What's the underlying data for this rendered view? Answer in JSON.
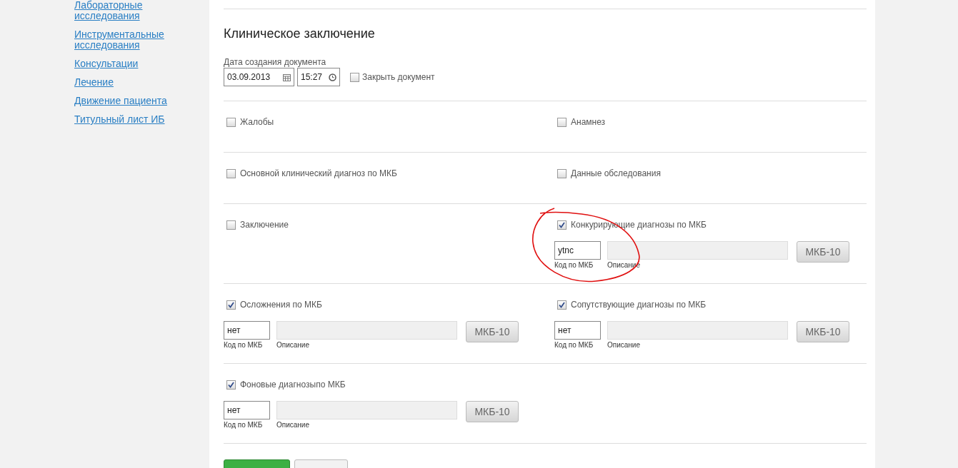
{
  "sidebar": {
    "links": [
      "Лабораторные исследования",
      "Инструментальные исследования",
      "Консультации",
      "Лечение",
      "Движение пациента",
      "Титульный лист ИБ"
    ]
  },
  "form": {
    "title": "Клиническое заключение",
    "date_label": "Дата создания документа",
    "date": "03.09.2013",
    "time": "15:27",
    "close_document": {
      "label": "Закрыть документ",
      "checked": false
    }
  },
  "rows": [
    [
      {
        "label": "Жалобы",
        "checked": false
      },
      {
        "label": "Анамнез",
        "checked": false
      }
    ],
    [
      {
        "label": "Основной клинический диагноз по МКБ",
        "checked": false
      },
      {
        "label": "Данные обследования",
        "checked": false
      }
    ],
    [
      {
        "label": "Заключение",
        "checked": false
      },
      {
        "label": "Конкурирующие диагнозы по МКБ",
        "checked": true,
        "highlighted": true,
        "code": "ytnc",
        "code_caption": "Код по МКБ",
        "description_caption": "Описание",
        "button": "МКБ-10"
      }
    ],
    [
      {
        "label": "Осложнения по МКБ",
        "checked": true,
        "code": "нет",
        "code_caption": "Код по МКБ",
        "description_caption": "Описание",
        "button": "МКБ-10"
      },
      {
        "label": "Сопутствующие диагнозы по МКБ",
        "checked": true,
        "code": "нет",
        "code_caption": "Код по МКБ",
        "description_caption": "Описание",
        "button": "МКБ-10"
      }
    ],
    [
      {
        "label": "Фоновые диагнозыпо МКБ",
        "checked": true,
        "code": "нет",
        "code_caption": "Код по МКБ",
        "description_caption": "Описание",
        "button": "МКБ-10"
      }
    ]
  ]
}
